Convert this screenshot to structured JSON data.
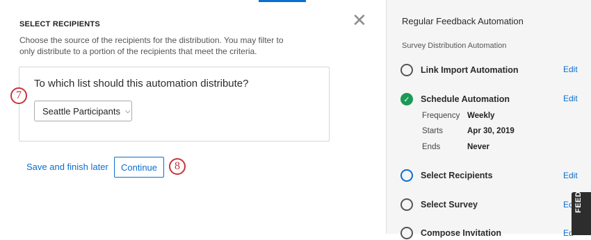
{
  "left": {
    "section_title": "SELECT RECIPIENTS",
    "description": "Choose the source of the recipients for the distribution. You may filter to only distribute to a portion of the recipients that meet the criteria.",
    "close_glyph": "✕",
    "question": "To which list should this automation distribute?",
    "list_select": {
      "value": "Seattle Participants",
      "chevron": "⌵"
    },
    "save_link": "Save and finish later",
    "continue_button": "Continue"
  },
  "callouts": {
    "seven": "7",
    "eight": "8"
  },
  "right": {
    "title": "Regular Feedback Automation",
    "subtitle": "Survey Distribution Automation",
    "edit_label": "Edit",
    "edit_label_cut": "Ed",
    "steps": [
      {
        "label": "Link Import Automation",
        "status": "pending"
      },
      {
        "label": "Schedule Automation",
        "status": "done",
        "check": "✓"
      },
      {
        "label": "Select Recipients",
        "status": "active"
      },
      {
        "label": "Select Survey",
        "status": "pending"
      },
      {
        "label": "Compose Invitation",
        "status": "pending"
      }
    ],
    "schedule_details": [
      {
        "label": "Frequency",
        "value": "Weekly"
      },
      {
        "label": "Starts",
        "value": "Apr 30, 2019"
      },
      {
        "label": "Ends",
        "value": "Never"
      }
    ]
  },
  "feedback_tab": "FEEDBACK",
  "colors": {
    "accent": "#0b6ed1",
    "done": "#1a9a55",
    "callout": "#c9333a",
    "panel_bg": "#f5f5f5"
  }
}
